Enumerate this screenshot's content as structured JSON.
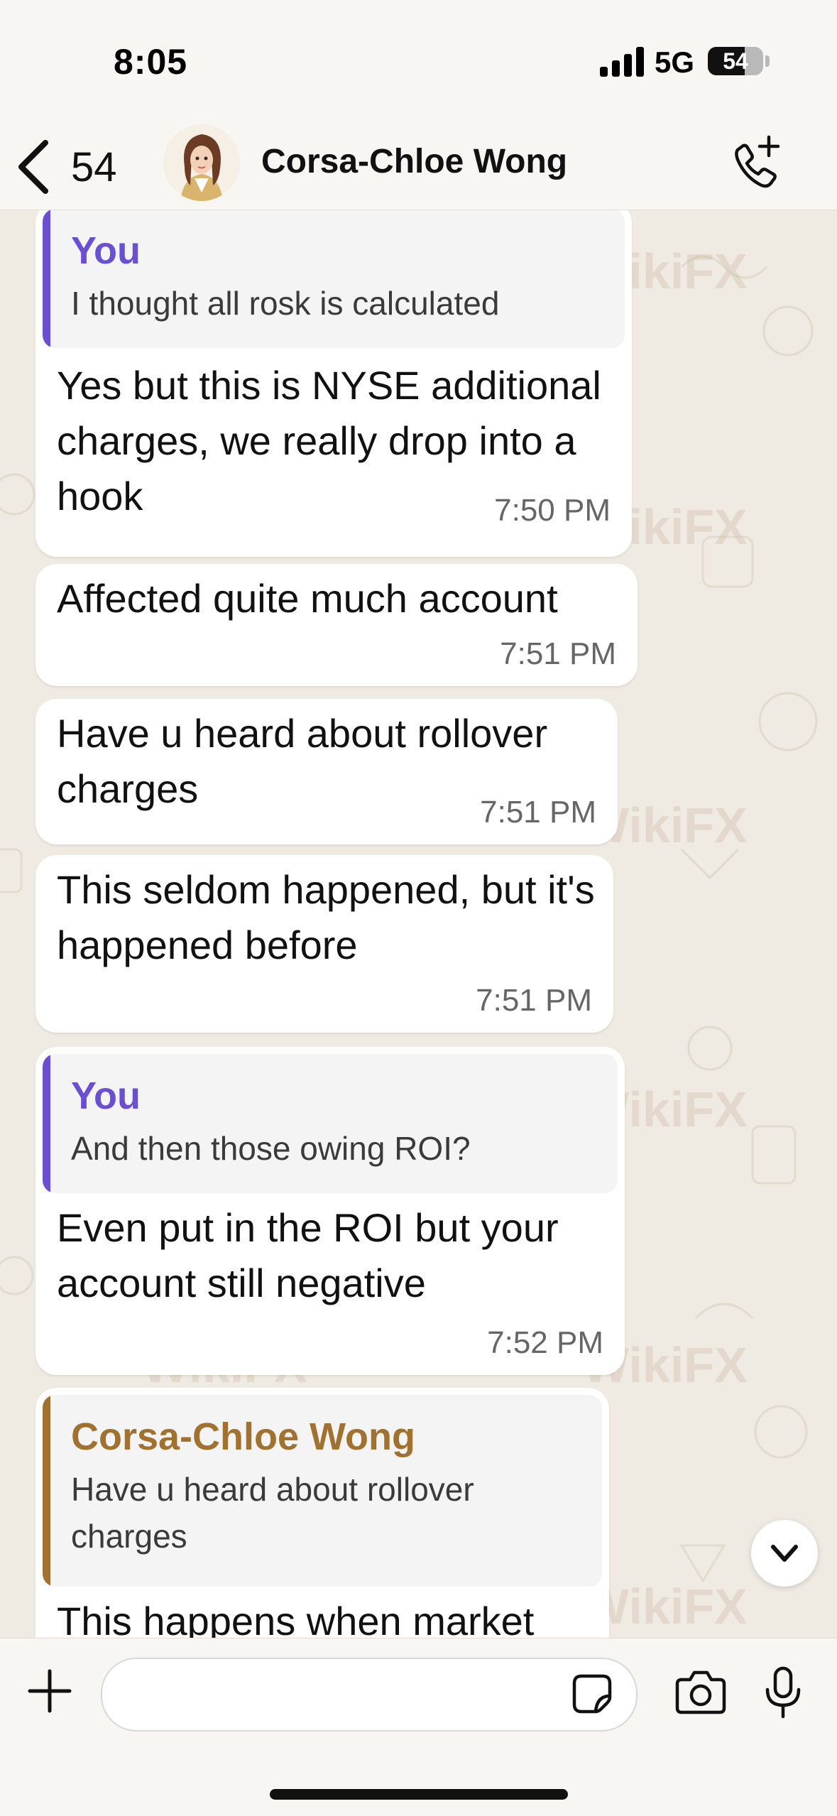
{
  "status_bar": {
    "time": "8:05",
    "network": "5G",
    "battery": "54"
  },
  "header": {
    "back_count": "54",
    "contact_name": "Corsa-Chloe Wong"
  },
  "colors": {
    "you_accent": "#6a4fd3",
    "contact_accent": "#a0712f",
    "chat_bg": "#efeae2"
  },
  "messages": [
    {
      "quote_author": "You",
      "quote_text": "I thought all rosk is calculated",
      "text": "Yes but this is NYSE additional charges, we really drop into a hook",
      "time": "7:50 PM"
    },
    {
      "text": "Affected quite much account",
      "time": "7:51 PM"
    },
    {
      "text": "Have u heard about rollover charges",
      "time": "7:51 PM"
    },
    {
      "text": "This seldom happened, but it's happened before",
      "time": "7:51 PM"
    },
    {
      "quote_author": "You",
      "quote_text": "And then those owing ROI?",
      "text": "Even put in the ROI but your account still negative",
      "time": "7:52 PM"
    },
    {
      "quote_author": "Corsa-Chloe Wong",
      "quote_text": "Have u heard about rollover charges",
      "text": "This happens when market"
    }
  ],
  "watermark": "WikiFX",
  "icons": [
    "signal-icon",
    "battery-icon",
    "back-chevron-icon",
    "avatar",
    "phone-add-icon",
    "chevron-down-icon",
    "plus-icon",
    "sticker-icon",
    "camera-icon",
    "mic-icon"
  ]
}
